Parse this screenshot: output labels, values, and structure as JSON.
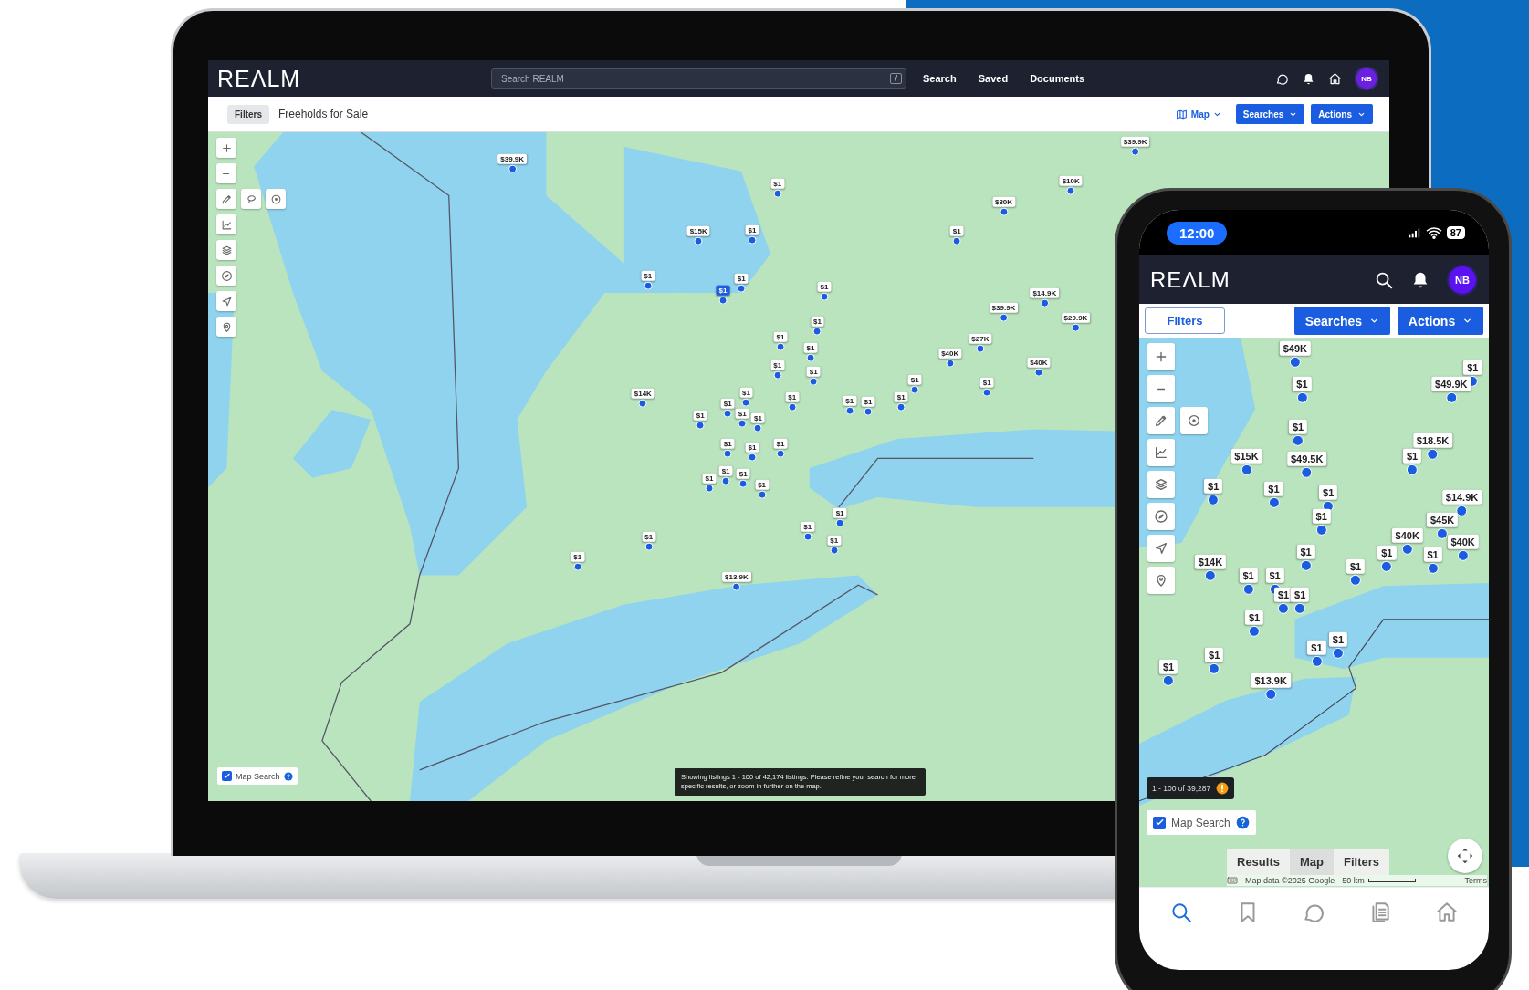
{
  "laptop": {
    "header": {
      "logo": "REΛLM",
      "search": {
        "placeholder": "Search REALM",
        "shortcut": "/"
      },
      "nav": [
        "Search",
        "Saved",
        "Documents"
      ],
      "avatar": "NB"
    },
    "toolbar": {
      "filters": "Filters",
      "title": "Freeholds for Sale",
      "view": "Map",
      "searches": "Searches",
      "actions": "Actions"
    },
    "map": {
      "pins": [
        {
          "label": "$39.9K",
          "selected": false
        },
        {
          "label": "$1",
          "selected": false
        },
        {
          "label": "$15K",
          "selected": false
        },
        {
          "label": "$1",
          "selected": false
        },
        {
          "label": "$1",
          "selected": false
        },
        {
          "label": "$1",
          "selected": true
        },
        {
          "label": "$1",
          "selected": false
        },
        {
          "label": "$1",
          "selected": false
        },
        {
          "label": "$1",
          "selected": false
        },
        {
          "label": "$1",
          "selected": false
        },
        {
          "label": "$1",
          "selected": false
        },
        {
          "label": "$1",
          "selected": false
        },
        {
          "label": "$1",
          "selected": false
        },
        {
          "label": "$14K",
          "selected": false
        },
        {
          "label": "$1",
          "selected": false
        },
        {
          "label": "$1",
          "selected": false
        },
        {
          "label": "$1",
          "selected": false
        },
        {
          "label": "$1",
          "selected": false
        },
        {
          "label": "$1",
          "selected": false
        },
        {
          "label": "$1",
          "selected": false
        },
        {
          "label": "$1",
          "selected": false
        },
        {
          "label": "$1",
          "selected": false
        },
        {
          "label": "$1",
          "selected": false
        },
        {
          "label": "$1",
          "selected": false
        },
        {
          "label": "$1",
          "selected": false
        },
        {
          "label": "$1",
          "selected": false
        },
        {
          "label": "$1",
          "selected": false
        },
        {
          "label": "$1",
          "selected": false
        },
        {
          "label": "$1",
          "selected": false
        },
        {
          "label": "$1",
          "selected": false
        },
        {
          "label": "$1",
          "selected": false
        },
        {
          "label": "$1",
          "selected": false
        },
        {
          "label": "$40K",
          "selected": false
        },
        {
          "label": "$27K",
          "selected": false
        },
        {
          "label": "$39.9K",
          "selected": false
        },
        {
          "label": "$14.9K",
          "selected": false
        },
        {
          "label": "$29.9K",
          "selected": false
        },
        {
          "label": "$40K",
          "selected": false
        },
        {
          "label": "$1",
          "selected": false
        },
        {
          "label": "$30K",
          "selected": false
        },
        {
          "label": "$10K",
          "selected": false
        },
        {
          "label": "$39.9K",
          "selected": false
        },
        {
          "label": "$1",
          "selected": false
        },
        {
          "label": "$1",
          "selected": false
        },
        {
          "label": "$1",
          "selected": false
        },
        {
          "label": "$1",
          "selected": false
        },
        {
          "label": "$1",
          "selected": false
        },
        {
          "label": "$13.9K",
          "selected": false
        }
      ],
      "map_search": {
        "label": "Map Search",
        "checked": true
      },
      "notice": "Showing listings 1 - 100 of 42,174 listings. Please refine your search for more specific results, or zoom in further on the map."
    }
  },
  "phone": {
    "status_bar": {
      "time": "12:00",
      "battery": "87"
    },
    "header": {
      "logo": "REΛLM",
      "avatar": "NB"
    },
    "toolbar": {
      "filters": "Filters",
      "searches": "Searches",
      "actions": "Actions"
    },
    "map": {
      "pins": [
        {
          "label": "$49K",
          "selected": false
        },
        {
          "label": "$1",
          "selected": false
        },
        {
          "label": "$1",
          "selected": false
        },
        {
          "label": "$49.9K",
          "selected": false
        },
        {
          "label": "$1",
          "selected": false
        },
        {
          "label": "$18.5K",
          "selected": false
        },
        {
          "label": "$15K",
          "selected": false
        },
        {
          "label": "$49.5K",
          "selected": false
        },
        {
          "label": "$1",
          "selected": false
        },
        {
          "label": "$1",
          "selected": false
        },
        {
          "label": "$1",
          "selected": false
        },
        {
          "label": "$1",
          "selected": false
        },
        {
          "label": "$14.9K",
          "selected": false
        },
        {
          "label": "$1",
          "selected": false
        },
        {
          "label": "$45K",
          "selected": false
        },
        {
          "label": "$40K",
          "selected": false
        },
        {
          "label": "$40K",
          "selected": false
        },
        {
          "label": "$14K",
          "selected": false
        },
        {
          "label": "$1",
          "selected": false
        },
        {
          "label": "$1",
          "selected": false
        },
        {
          "label": "$1",
          "selected": false
        },
        {
          "label": "$1",
          "selected": false
        },
        {
          "label": "$1",
          "selected": false
        },
        {
          "label": "$1",
          "selected": false
        },
        {
          "label": "$1",
          "selected": false
        },
        {
          "label": "$1",
          "selected": false
        },
        {
          "label": "$1",
          "selected": false
        },
        {
          "label": "$1",
          "selected": false
        },
        {
          "label": "$1",
          "selected": false
        },
        {
          "label": "$1",
          "selected": false
        },
        {
          "label": "$1",
          "selected": false
        },
        {
          "label": "$13.9K",
          "selected": false
        }
      ],
      "count": "1 - 100 of 39,287",
      "map_search": {
        "label": "Map Search",
        "checked": true
      },
      "view_tabs": [
        {
          "label": "Results",
          "selected": false
        },
        {
          "label": "Map",
          "selected": true
        },
        {
          "label": "Filters",
          "selected": false
        }
      ],
      "attribution": "Map data ©2025 Google",
      "scale": "50 km",
      "terms": "Terms"
    },
    "nav": [
      {
        "selected": true
      },
      {
        "selected": false
      },
      {
        "selected": false
      },
      {
        "selected": false
      },
      {
        "selected": false
      }
    ]
  }
}
